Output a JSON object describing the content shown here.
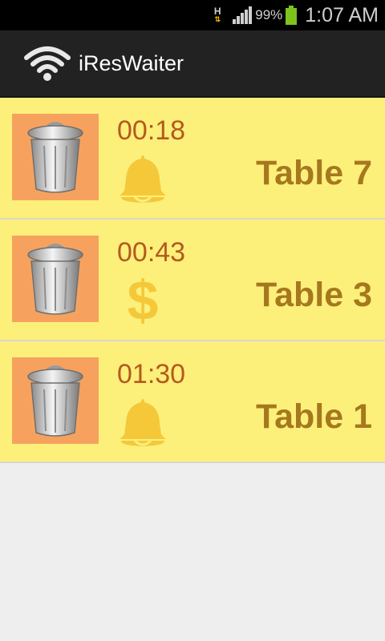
{
  "statusbar": {
    "network": "H",
    "battery_percent": "99%",
    "time": "1:07 AM",
    "battery_color": "#7ec21c"
  },
  "actionbar": {
    "title": "iResWaiter",
    "logo_icon": "wifi-icon"
  },
  "orders": [
    {
      "time": "00:18",
      "status_icon": "bell-icon",
      "table": "Table 7"
    },
    {
      "time": "00:43",
      "status_icon": "dollar-icon",
      "table": "Table 3"
    },
    {
      "time": "01:30",
      "status_icon": "bell-icon",
      "table": "Table 1"
    }
  ],
  "colors": {
    "row_bg": "#fcf07b",
    "delete_bg": "#f6a25e",
    "time_text": "#b45a1e",
    "table_text": "#a6781e",
    "icon_yellow": "#f5c83a"
  }
}
